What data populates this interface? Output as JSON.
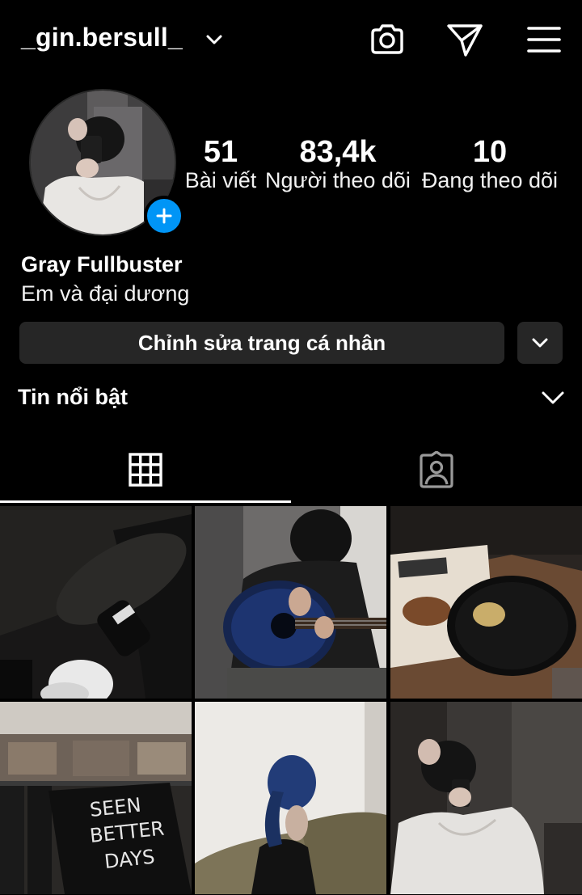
{
  "header": {
    "username": "_gin.bersull_",
    "icons": {
      "account_switch": "chevron-down-icon",
      "camera": "camera-icon",
      "direct": "paper-plane-icon",
      "menu": "hamburger-menu-icon"
    }
  },
  "profile": {
    "avatar_alt": "Profile photo",
    "stats": {
      "posts": {
        "value": "51",
        "label": "Bài viết"
      },
      "followers": {
        "value": "83,4k",
        "label": "Người theo dõi"
      },
      "following": {
        "value": "10",
        "label": "Đang theo dõi"
      }
    },
    "display_name": "Gray Fullbuster",
    "bio": "Em và đại dương",
    "edit_button": "Chỉnh sửa trang cá nhân"
  },
  "highlights": {
    "label": "Tin nổi bật"
  },
  "tabs": [
    {
      "name": "posts-grid",
      "icon": "grid-icon",
      "active": true
    },
    {
      "name": "tagged",
      "icon": "tagged-person-icon",
      "active": false
    }
  ],
  "posts": [
    {
      "id": "post-1",
      "caption": "Shoes on dark floor"
    },
    {
      "id": "post-2",
      "caption": "Playing blue guitar"
    },
    {
      "id": "post-3",
      "caption": "Vinyl record on table"
    },
    {
      "id": "post-4",
      "caption": "Shop t-shirt rack",
      "print_text": "SEEN BETTER DAYS"
    },
    {
      "id": "post-5",
      "caption": "Girl with blue hair"
    },
    {
      "id": "post-6",
      "caption": "Mirror selfie"
    }
  ],
  "colors": {
    "background": "#000000",
    "button": "#262626",
    "accent_blue": "#0095f6",
    "text": "#ffffff"
  }
}
